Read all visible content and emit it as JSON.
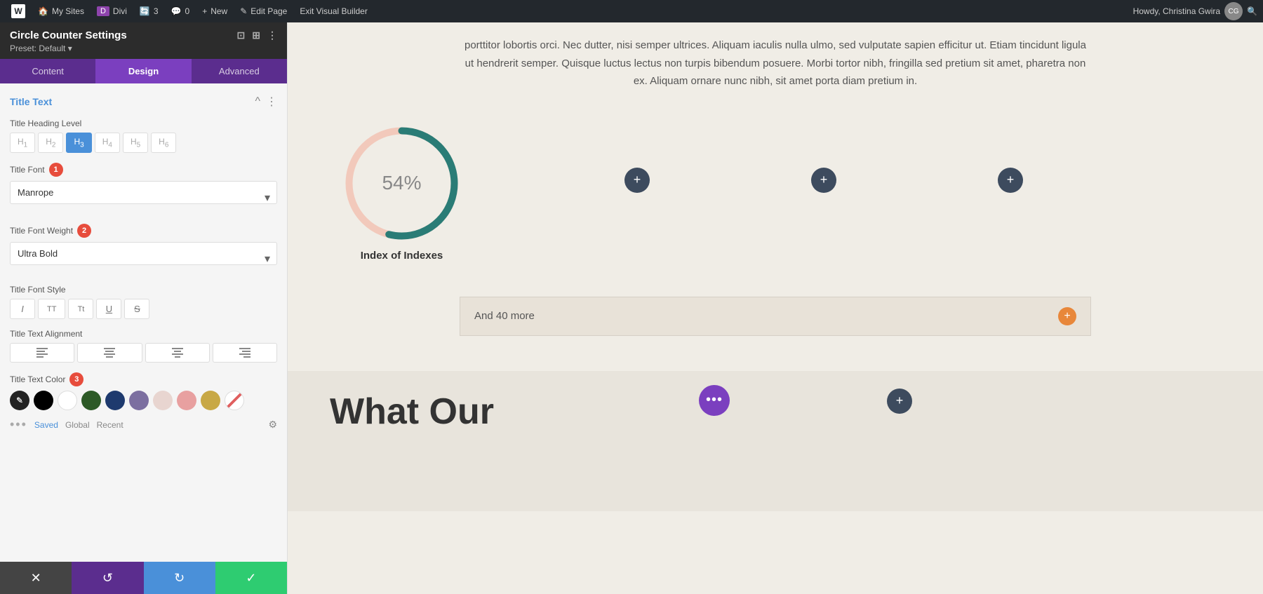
{
  "adminBar": {
    "wpIcon": "W",
    "items": [
      {
        "label": "My Sites",
        "icon": "🏠"
      },
      {
        "label": "Divi",
        "icon": "D"
      },
      {
        "label": "3",
        "icon": "🔄"
      },
      {
        "label": "0",
        "icon": "💬"
      },
      {
        "label": "New",
        "icon": "+"
      },
      {
        "label": "Edit Page",
        "icon": "✎"
      },
      {
        "label": "Exit Visual Builder",
        "icon": ""
      }
    ],
    "user": "Howdy, Christina Gwira",
    "searchIcon": "🔍"
  },
  "leftPanel": {
    "title": "Circle Counter Settings",
    "iconResize": "⊡",
    "iconDock": "⊞",
    "iconMore": "⋮",
    "preset": "Preset: Default",
    "tabs": [
      {
        "label": "Content",
        "active": false
      },
      {
        "label": "Design",
        "active": true
      },
      {
        "label": "Advanced",
        "active": false
      }
    ],
    "sections": {
      "titleText": {
        "label": "Title Text",
        "collapseIcon": "^",
        "moreIcon": "⋮",
        "headingLevel": {
          "label": "Title Heading Level",
          "options": [
            "H1",
            "H2",
            "H3",
            "H4",
            "H5",
            "H6"
          ],
          "active": "H3"
        },
        "titleFont": {
          "label": "Title Font",
          "badgeNum": "1",
          "value": "Manrope"
        },
        "titleFontWeight": {
          "label": "Title Font Weight",
          "badgeNum": "2",
          "value": "Ultra Bold"
        },
        "titleFontStyle": {
          "label": "Title Font Style",
          "buttons": [
            "I",
            "TT",
            "Tt",
            "U",
            "S"
          ]
        },
        "titleTextAlignment": {
          "label": "Title Text Alignment",
          "buttons": [
            "left",
            "center-left",
            "center",
            "right"
          ]
        },
        "titleTextColor": {
          "label": "Title Text Color",
          "badgeNum": "3",
          "colors": [
            {
              "value": "#222222",
              "isPicker": true
            },
            {
              "value": "#000000"
            },
            {
              "value": "#ffffff"
            },
            {
              "value": "#2d5a27"
            },
            {
              "value": "#1e3a6e"
            },
            {
              "value": "#7c6fa0"
            },
            {
              "value": "#e8d5d0"
            },
            {
              "value": "#e8a0a0"
            },
            {
              "value": "#c8a845"
            },
            {
              "value": "#e06060",
              "isSlash": true
            }
          ],
          "tabs": [
            {
              "label": "Saved",
              "active": true
            },
            {
              "label": "Global",
              "active": false
            },
            {
              "label": "Recent",
              "active": false
            }
          ],
          "settingsIcon": "⚙"
        }
      }
    }
  },
  "bottomBar": {
    "cancel": "✕",
    "undo": "↺",
    "redo": "↻",
    "save": "✓"
  },
  "contentArea": {
    "bodyText": "porttitor lobortis orci. Nec dutter, nisi semper ultrices. Aliquam iaculis nulla ulmo, sed vulputate sapien efficitur ut. Etiam tincidunt ligula ut hendrerit semper. Quisque luctus lectus non turpis bibendum posuere. Morbi tortor nibh, fringilla sed pretium sit amet, pharetra non ex. Aliquam ornare nunc nibh, sit amet porta diam pretium in.",
    "circleCounter": {
      "percentage": "54%",
      "progressValue": 54,
      "title": "Index of Indexes"
    },
    "plusButtons": [
      "+",
      "+",
      "+"
    ],
    "andMore": {
      "text": "And 40 more",
      "plusIcon": "+"
    },
    "bottomSection": {
      "title": "What Our",
      "dotsIcon": "•••",
      "plusIcon": "+"
    }
  }
}
